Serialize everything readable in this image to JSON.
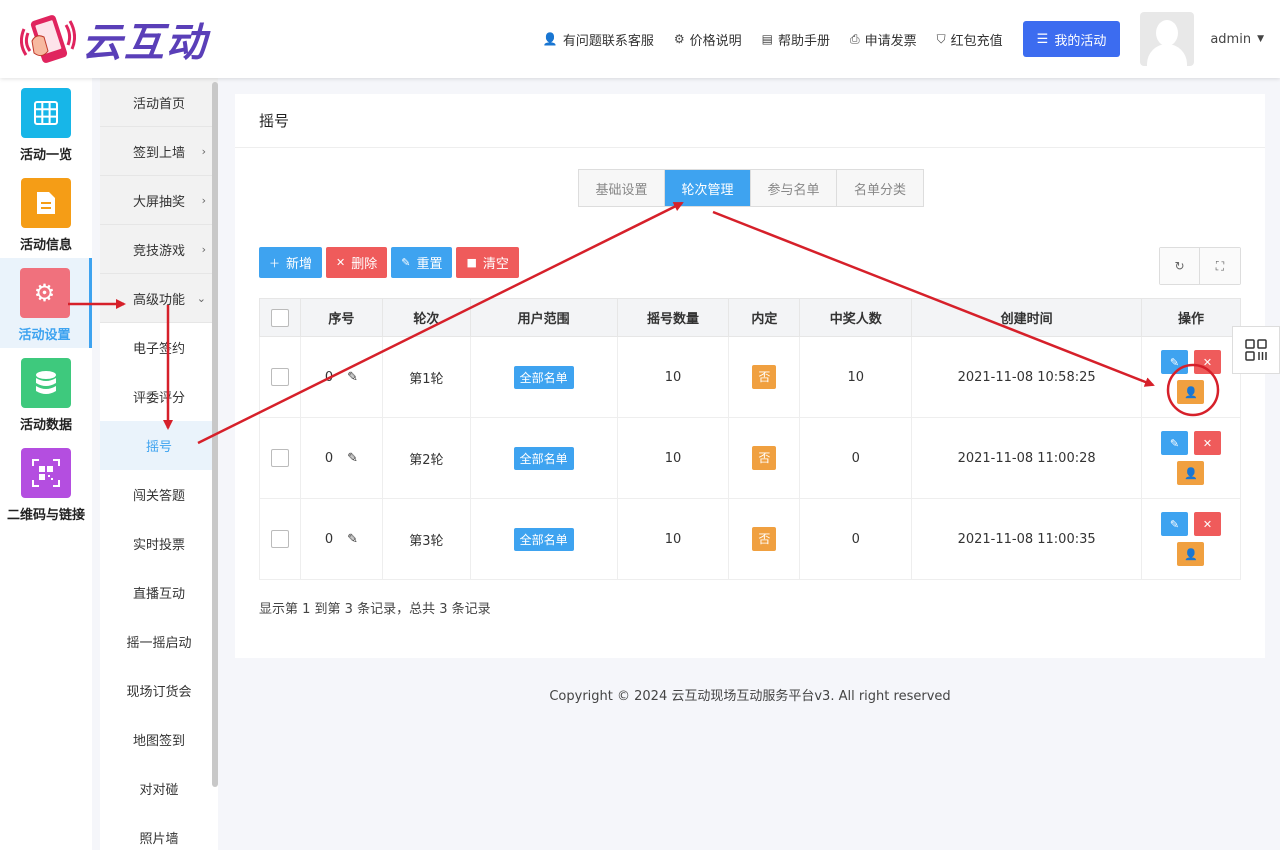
{
  "brand": {
    "name": "云互动"
  },
  "topnav": {
    "items": [
      {
        "icon": "user-plus-icon",
        "label": "有问题联系客服"
      },
      {
        "icon": "gear-icon",
        "label": "价格说明"
      },
      {
        "icon": "book-icon",
        "label": "帮助手册"
      },
      {
        "icon": "printer-icon",
        "label": "申请发票"
      },
      {
        "icon": "shield-icon",
        "label": "红包充值"
      }
    ],
    "my_activity": "我的活动",
    "user": "admin"
  },
  "rail": [
    {
      "label": "活动一览",
      "color": "#17b6e8",
      "icon": "grid-icon"
    },
    {
      "label": "活动信息",
      "color": "#f59d16",
      "icon": "document-icon"
    },
    {
      "label": "活动设置",
      "color": "#f0717d",
      "icon": "gear-icon",
      "active": true
    },
    {
      "label": "活动数据",
      "color": "#3ec97d",
      "icon": "database-icon"
    },
    {
      "label": "二维码与链接",
      "color": "#b44ee0",
      "icon": "qrcode-icon"
    }
  ],
  "submenu": [
    {
      "label": "活动首页",
      "grey": true
    },
    {
      "label": "签到上墙",
      "grey": true,
      "chevron": "›"
    },
    {
      "label": "大屏抽奖",
      "grey": true,
      "chevron": "›"
    },
    {
      "label": "竞技游戏",
      "grey": true,
      "chevron": "›"
    },
    {
      "label": "高级功能",
      "grey": true,
      "chevron": "⌄"
    },
    {
      "label": "电子签约"
    },
    {
      "label": "评委评分"
    },
    {
      "label": "摇号",
      "active": true
    },
    {
      "label": "闯关答题"
    },
    {
      "label": "实时投票"
    },
    {
      "label": "直播互动"
    },
    {
      "label": "摇一摇启动"
    },
    {
      "label": "现场订货会"
    },
    {
      "label": "地图签到"
    },
    {
      "label": "对对碰"
    },
    {
      "label": "照片墙"
    }
  ],
  "page": {
    "title": "摇号",
    "tabs": [
      "基础设置",
      "轮次管理",
      "参与名单",
      "名单分类"
    ],
    "active_tab": 1,
    "toolbar": {
      "add": "新增",
      "delete": "删除",
      "reset": "重置",
      "clear": "清空"
    },
    "table": {
      "headers": [
        "序号",
        "轮次",
        "用户范围",
        "摇号数量",
        "内定",
        "中奖人数",
        "创建时间",
        "操作"
      ],
      "rows": [
        {
          "seq": "0",
          "round": "第1轮",
          "scope": "全部名单",
          "count": "10",
          "fixed": "否",
          "winners": "10",
          "created": "2021-11-08 10:58:25"
        },
        {
          "seq": "0",
          "round": "第2轮",
          "scope": "全部名单",
          "count": "10",
          "fixed": "否",
          "winners": "0",
          "created": "2021-11-08 11:00:28"
        },
        {
          "seq": "0",
          "round": "第3轮",
          "scope": "全部名单",
          "count": "10",
          "fixed": "否",
          "winners": "0",
          "created": "2021-11-08 11:00:35"
        }
      ]
    },
    "records": "显示第 1 到第 3 条记录，总共 3 条记录"
  },
  "footer": "Copyright © 2024 云互动现场互动服务平台v3. All right reserved"
}
